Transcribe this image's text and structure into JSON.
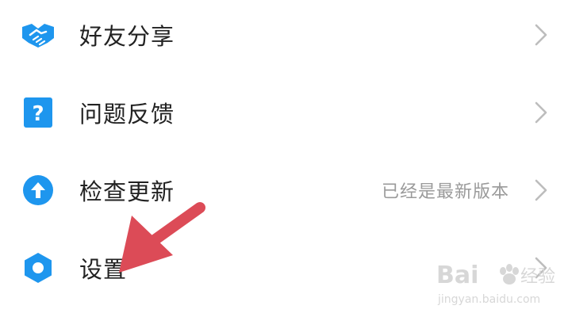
{
  "menu": {
    "items": [
      {
        "label": "好友分享",
        "icon": "handshake-icon",
        "status": ""
      },
      {
        "label": "问题反馈",
        "icon": "question-icon",
        "status": ""
      },
      {
        "label": "检查更新",
        "icon": "upload-arrow-icon",
        "status": "已经是最新版本"
      },
      {
        "label": "设置",
        "icon": "hexagon-settings-icon",
        "status": ""
      }
    ]
  },
  "watermark": {
    "brand": "Bai",
    "brand_cn": "经验",
    "url": "jingyan.baidu.com"
  },
  "colors": {
    "icon_blue": "#1e96ee",
    "annotation_red": "#dc4b57",
    "chevron": "#bdbdbd"
  }
}
